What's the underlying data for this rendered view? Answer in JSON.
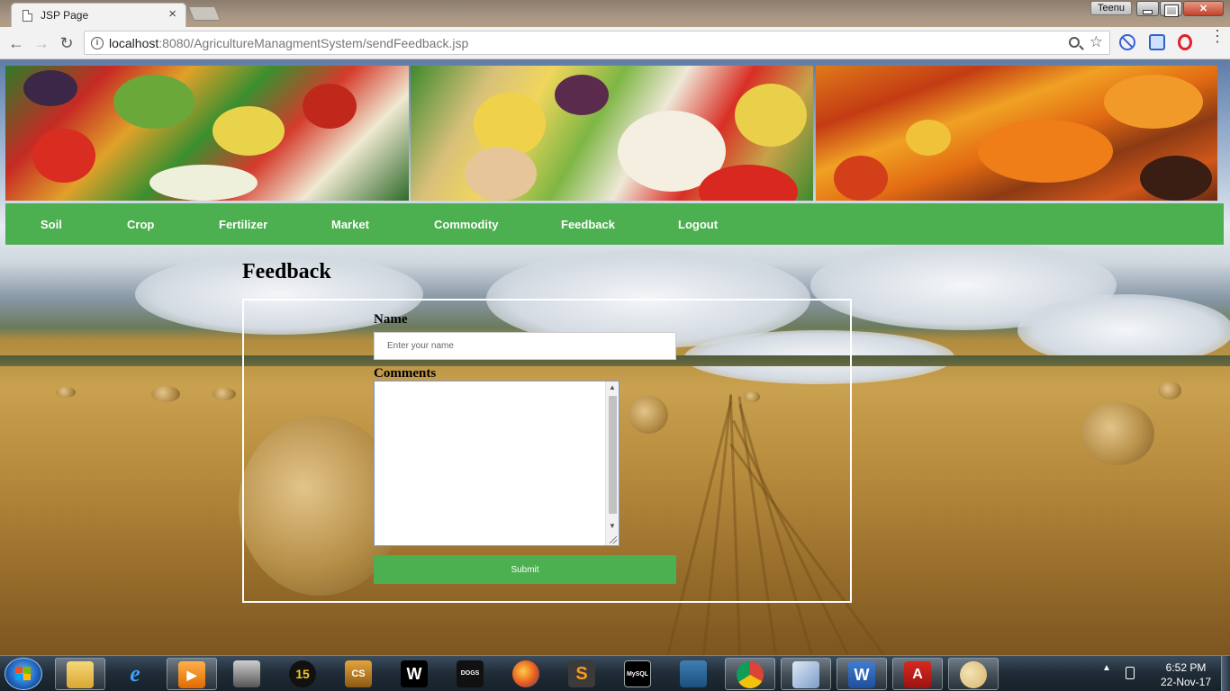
{
  "browser": {
    "tab_title": "JSP Page",
    "tab_close": "×",
    "user_badge": "Teenu",
    "url_host": "localhost",
    "url_rest": ":8080/AgricultureManagmentSystem/sendFeedback.jsp",
    "back": "←",
    "forward": "→",
    "reload": "↻",
    "star": "☆",
    "menu": "⋮",
    "info": "i"
  },
  "nav": {
    "items": [
      {
        "label": "Soil"
      },
      {
        "label": "Crop"
      },
      {
        "label": "Fertilizer"
      },
      {
        "label": "Market"
      },
      {
        "label": "Commodity"
      },
      {
        "label": "Feedback"
      },
      {
        "label": "Logout"
      }
    ],
    "color": "#4caf50"
  },
  "page": {
    "title": "Feedback"
  },
  "form": {
    "name_label": "Name",
    "name_placeholder": "Enter your name",
    "name_value": "",
    "comments_label": "Comments",
    "comments_value": "",
    "submit_label": "Submit",
    "scroll_up": "▲",
    "scroll_down": "▼"
  },
  "taskbar": {
    "apps": [
      {
        "name": "windows-explorer",
        "icon": "folder-icon",
        "label": ""
      },
      {
        "name": "internet-explorer",
        "icon": "ie-icon",
        "label": "e"
      },
      {
        "name": "media-player",
        "icon": "media-icon",
        "label": "▶"
      },
      {
        "name": "game-1",
        "icon": "game-icon",
        "label": ""
      },
      {
        "name": "pes-15",
        "icon": "game-15-icon",
        "label": "15"
      },
      {
        "name": "counter-strike",
        "icon": "cs-icon",
        "label": "CS"
      },
      {
        "name": "wwe",
        "icon": "wwe-icon",
        "label": "W"
      },
      {
        "name": "sleeping-dogs",
        "icon": "sleeping-dogs-icon",
        "label": "DOGS"
      },
      {
        "name": "firefox",
        "icon": "firefox-icon",
        "label": ""
      },
      {
        "name": "sublime-text",
        "icon": "sublime-icon",
        "label": "S"
      },
      {
        "name": "mysql-console",
        "icon": "mysql-console-icon",
        "label": "MySQL"
      },
      {
        "name": "mysql-workbench",
        "icon": "dolphin-icon",
        "label": ""
      },
      {
        "name": "chrome",
        "icon": "chrome-icon",
        "label": ""
      },
      {
        "name": "virtualbox",
        "icon": "cube-icon",
        "label": ""
      },
      {
        "name": "word",
        "icon": "word-icon",
        "label": "W"
      },
      {
        "name": "acrobat",
        "icon": "pdf-icon",
        "label": "A"
      },
      {
        "name": "paint",
        "icon": "palette-icon",
        "label": ""
      }
    ],
    "tray_arrow": "▲",
    "time": "6:52 PM",
    "date": "22-Nov-17"
  }
}
